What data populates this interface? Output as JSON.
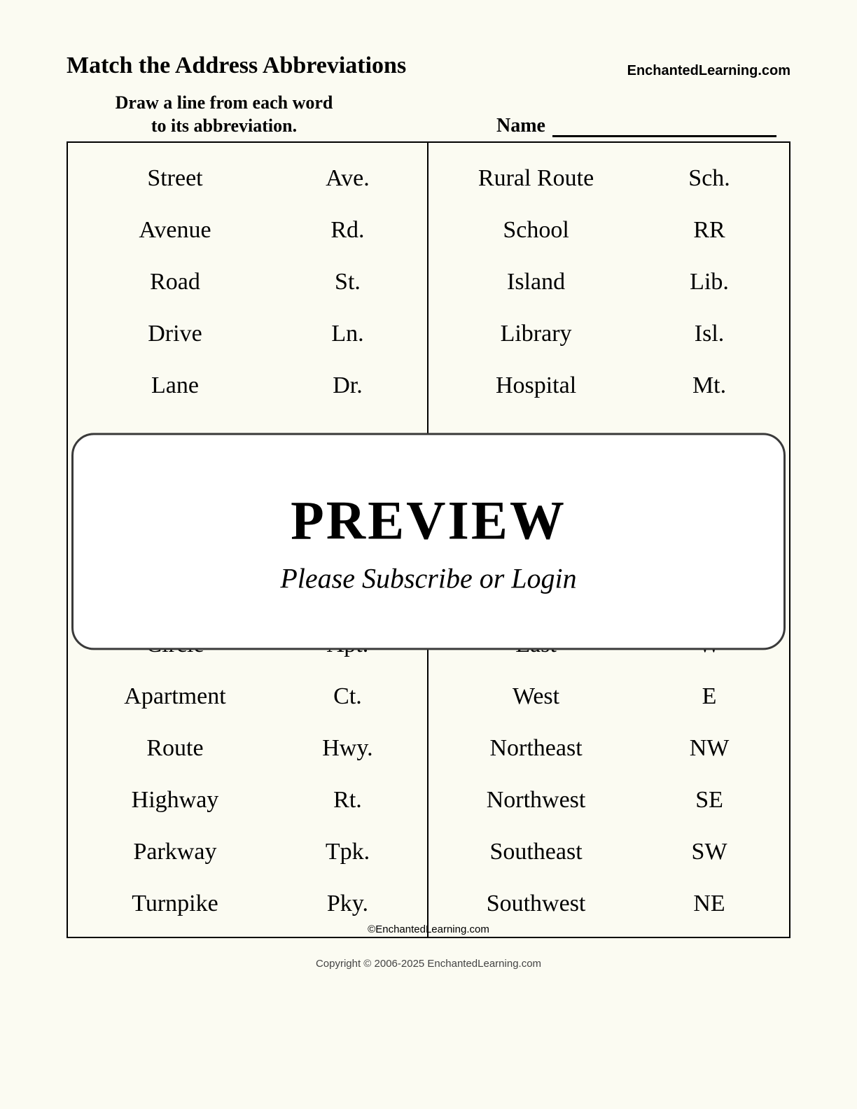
{
  "header": {
    "title": "Match the Address Abbreviations",
    "brand": "EnchantedLearning.com"
  },
  "subheader": {
    "instruction_l1": "Draw a line from each word",
    "instruction_l2": "to its abbreviation.",
    "name_label": "Name"
  },
  "left": [
    {
      "word": "Street",
      "abbr": "Ave."
    },
    {
      "word": "Avenue",
      "abbr": "Rd."
    },
    {
      "word": "Road",
      "abbr": "St."
    },
    {
      "word": "Drive",
      "abbr": "Ln."
    },
    {
      "word": "Lane",
      "abbr": "Dr."
    },
    {
      "word": "",
      "abbr": ""
    },
    {
      "word": "",
      "abbr": ""
    },
    {
      "word": "",
      "abbr": ""
    },
    {
      "word": "",
      "abbr": ""
    },
    {
      "word": "Circle",
      "abbr": "Apt."
    },
    {
      "word": "Apartment",
      "abbr": "Ct."
    },
    {
      "word": "Route",
      "abbr": "Hwy."
    },
    {
      "word": "Highway",
      "abbr": "Rt."
    },
    {
      "word": "Parkway",
      "abbr": "Tpk."
    },
    {
      "word": "Turnpike",
      "abbr": "Pky."
    }
  ],
  "right": [
    {
      "word": "Rural Route",
      "abbr": "Sch."
    },
    {
      "word": "School",
      "abbr": "RR"
    },
    {
      "word": "Island",
      "abbr": "Lib."
    },
    {
      "word": "Library",
      "abbr": "Isl."
    },
    {
      "word": "Hospital",
      "abbr": "Mt."
    },
    {
      "word": "",
      "abbr": ""
    },
    {
      "word": "",
      "abbr": ""
    },
    {
      "word": "",
      "abbr": ""
    },
    {
      "word": "",
      "abbr": ""
    },
    {
      "word": "East",
      "abbr": "W"
    },
    {
      "word": "West",
      "abbr": "E"
    },
    {
      "word": "Northeast",
      "abbr": "NW"
    },
    {
      "word": "Northwest",
      "abbr": "SE"
    },
    {
      "word": "Southeast",
      "abbr": "SW"
    },
    {
      "word": "Southwest",
      "abbr": "NE"
    }
  ],
  "overlay": {
    "title": "PREVIEW",
    "subtitle": "Please Subscribe or Login"
  },
  "copyright_inner": "©EnchantedLearning.com",
  "footer": "Copyright © 2006-2025 EnchantedLearning.com"
}
